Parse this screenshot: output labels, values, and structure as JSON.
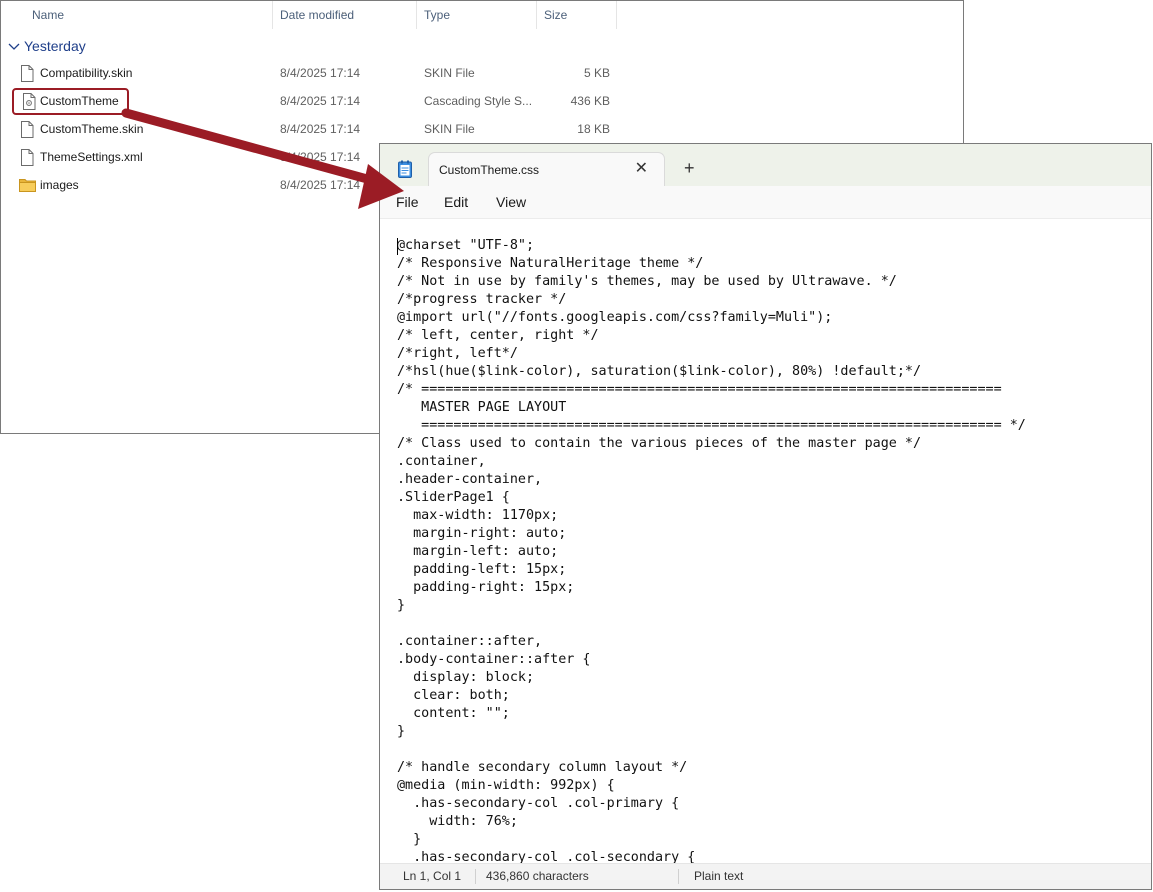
{
  "explorer": {
    "columns": {
      "name": "Name",
      "date": "Date modified",
      "type": "Type",
      "size": "Size"
    },
    "group_label": "Yesterday",
    "files": [
      {
        "name": "Compatibility.skin",
        "date": "8/4/2025 17:14",
        "type": "SKIN File",
        "size": "5 KB",
        "icon": "file-icon"
      },
      {
        "name": "CustomTheme",
        "date": "8/4/2025 17:14",
        "type": "Cascading Style S...",
        "size": "436 KB",
        "icon": "css-file-icon"
      },
      {
        "name": "CustomTheme.skin",
        "date": "8/4/2025 17:14",
        "type": "SKIN File",
        "size": "18 KB",
        "icon": "file-icon"
      },
      {
        "name": "ThemeSettings.xml",
        "date": "8/4/2025 17:14",
        "type": "",
        "size": "",
        "icon": "file-icon"
      },
      {
        "name": "images",
        "date": "8/4/2025 17:14",
        "type": "",
        "size": "",
        "icon": "folder-icon"
      }
    ]
  },
  "annotation": {
    "color": "#9b1c25"
  },
  "notepad": {
    "tab_title": "CustomTheme.css",
    "close_glyph": "✕",
    "new_tab_glyph": "+",
    "menu": {
      "file": "File",
      "edit": "Edit",
      "view": "View"
    },
    "content": "@charset \"UTF-8\";\n/* Responsive NaturalHeritage theme */\n/* Not in use by family's themes, may be used by Ultrawave. */\n/*progress tracker */\n@import url(\"//fonts.googleapis.com/css?family=Muli\");\n/* left, center, right */\n/*right, left*/\n/*hsl(hue($link-color), saturation($link-color), 80%) !default;*/\n/* ========================================================================\n   MASTER PAGE LAYOUT\n   ======================================================================== */\n/* Class used to contain the various pieces of the master page */\n.container,\n.header-container,\n.SliderPage1 {\n  max-width: 1170px;\n  margin-right: auto;\n  margin-left: auto;\n  padding-left: 15px;\n  padding-right: 15px;\n}\n\n.container::after,\n.body-container::after {\n  display: block;\n  clear: both;\n  content: \"\";\n}\n\n/* handle secondary column layout */\n@media (min-width: 992px) {\n  .has-secondary-col .col-primary {\n    width: 76%;\n  }\n  .has-secondary-col .col-secondary {",
    "status": {
      "position": "Ln 1, Col 1",
      "characters": "436,860 characters",
      "format": "Plain text"
    }
  }
}
